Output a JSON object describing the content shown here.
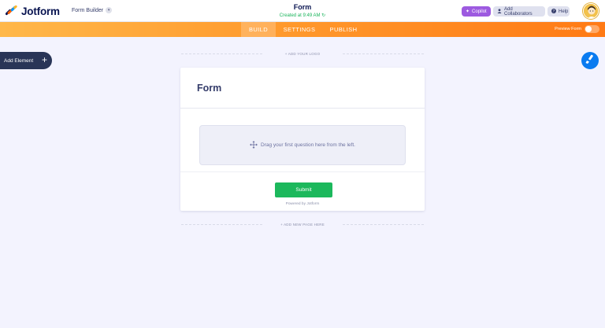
{
  "header": {
    "brand": "Jotform",
    "builder_label": "Form Builder",
    "form_title": "Form",
    "status": "Created at 9:49 AM",
    "copilot_label": "Copilot",
    "collaborators_label": "Add Collaborators",
    "help_label": "Help"
  },
  "nav": {
    "tabs": [
      {
        "label": "BUILD",
        "active": true
      },
      {
        "label": "SETTINGS",
        "active": false
      },
      {
        "label": "PUBLISH",
        "active": false
      }
    ],
    "preview_label": "Preview Form",
    "preview_enabled": false
  },
  "sidebar": {
    "add_element_label": "Add Element"
  },
  "canvas": {
    "add_logo_label": "+ ADD YOUR LOGO",
    "form_heading": "Form",
    "dropzone_text": "Drag your first question here from the left.",
    "submit_label": "Submit",
    "powered_by": "Powered by Jotform",
    "add_page_label": "+ ADD NEW PAGE HERE"
  },
  "colors": {
    "accent_orange": "#ff7a15",
    "submit_green": "#1cb85c",
    "copilot_purple": "#9d5ae0",
    "paint_blue": "#0a7bf0",
    "navy": "#0a1551"
  },
  "icons": [
    "jotform-logo-icon",
    "chevron-down-icon",
    "sparkle-icon",
    "user-icon",
    "help-circle-icon",
    "avatar",
    "plus-icon",
    "paint-brush-icon",
    "move-icon",
    "refresh-icon"
  ]
}
